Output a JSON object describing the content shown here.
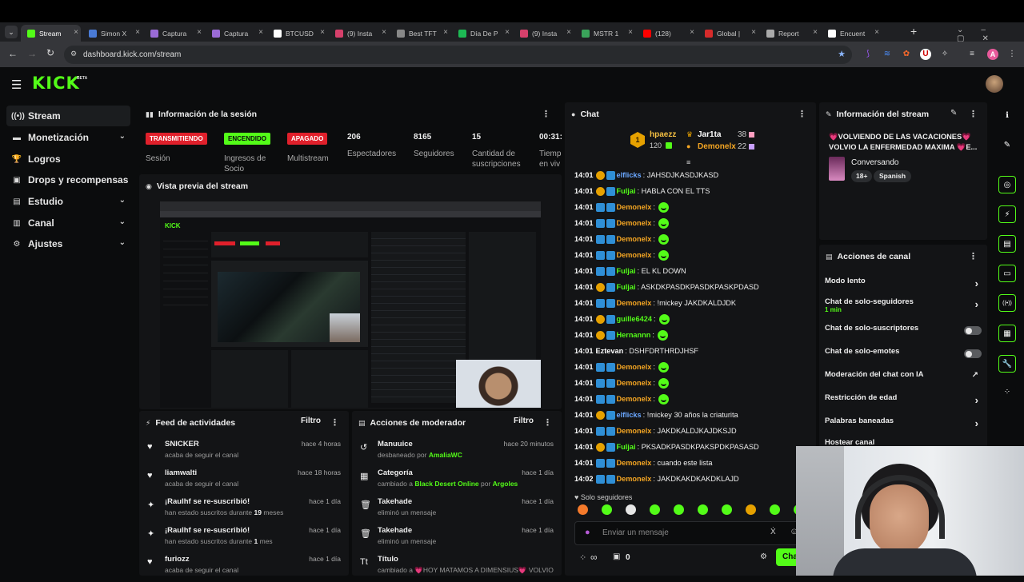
{
  "browser": {
    "tabs": [
      {
        "label": "Stream",
        "color": "#53fc18"
      },
      {
        "label": "Simon X",
        "color": "#4a7bd6"
      },
      {
        "label": "Captura",
        "color": "#9a6bd6"
      },
      {
        "label": "Captura",
        "color": "#9a6bd6"
      },
      {
        "label": "BTCUSD",
        "color": "#ffffff"
      },
      {
        "label": "(9) Insta",
        "color": "#d6406b"
      },
      {
        "label": "Best TFT",
        "color": "#888888"
      },
      {
        "label": "Día De P",
        "color": "#1db954"
      },
      {
        "label": "(9) Insta",
        "color": "#d6406b"
      },
      {
        "label": "MSTR 1",
        "color": "#3aa35a"
      },
      {
        "label": "(128)",
        "color": "#ff0000"
      },
      {
        "label": "Global |",
        "color": "#d62b2b"
      },
      {
        "label": "Report",
        "color": "#aaaaaa"
      },
      {
        "label": "Encuent",
        "color": "#ffffff"
      }
    ],
    "url": "dashboard.kick.com/stream"
  },
  "brand": {
    "logo": "KICK",
    "beta": "BETA",
    "accent": "#53fc18"
  },
  "sidebar": {
    "items": [
      {
        "label": "Stream",
        "icon": "broadcast-icon",
        "glyph": "((•))",
        "chevron": false
      },
      {
        "label": "Monetización",
        "icon": "money-icon",
        "glyph": "▬",
        "chevron": true
      },
      {
        "label": "Logros",
        "icon": "trophy-icon",
        "glyph": "🏆",
        "chevron": false
      },
      {
        "label": "Drops y recompensas",
        "icon": "gift-icon",
        "glyph": "▣",
        "chevron": false
      },
      {
        "label": "Estudio",
        "icon": "book-icon",
        "glyph": "▤",
        "chevron": true
      },
      {
        "label": "Canal",
        "icon": "channel-icon",
        "glyph": "▥",
        "chevron": true
      },
      {
        "label": "Ajustes",
        "icon": "gear-icon",
        "glyph": "⚙",
        "chevron": true
      }
    ]
  },
  "session": {
    "title": "Información de la sesión",
    "badges": [
      {
        "text": "TRANSMITIENDO",
        "label": "Sesión",
        "bg": "#e0202b",
        "fg": "#ffffff"
      },
      {
        "text": "ENCENDIDO",
        "label": "Ingresos de Socio",
        "bg": "#53fc18",
        "fg": "#0b0c0d"
      },
      {
        "text": "APAGADO",
        "label": "Multistream",
        "bg": "#e0202b",
        "fg": "#ffffff"
      }
    ],
    "stats": [
      {
        "value": "206",
        "label": "Espectadores"
      },
      {
        "value": "8165",
        "label": "Seguidores"
      },
      {
        "value": "15",
        "label": "Cantidad de suscripciones"
      },
      {
        "value": "00:31:",
        "label": "Tiemp en viv"
      }
    ]
  },
  "preview": {
    "title": "Vista previa del stream"
  },
  "feed": {
    "title": "Feed de actividades",
    "filter": "Filtro",
    "items": [
      {
        "icon": "heart-icon",
        "glyph": "♥",
        "name": "SNICKER",
        "sub": "acaba de seguir el canal",
        "time": "hace 4 horas"
      },
      {
        "icon": "heart-icon",
        "glyph": "♥",
        "name": "liamwalti",
        "sub": "acaba de seguir el canal",
        "time": "hace 18 horas"
      },
      {
        "icon": "sparkle-icon",
        "glyph": "✦",
        "name": "¡Raulhf se re-suscribió!",
        "sub_pre": "han estado suscritos durante ",
        "sub_num": "19",
        "sub_post": " meses",
        "time": "hace 1 día"
      },
      {
        "icon": "sparkle-icon",
        "glyph": "✦",
        "name": "¡Raulhf se re-suscribió!",
        "sub_pre": "han estado suscritos durante ",
        "sub_num": "1",
        "sub_post": " mes",
        "time": "hace 1 día"
      },
      {
        "icon": "heart-icon",
        "glyph": "♥",
        "name": "furiozz",
        "sub": "acaba de seguir el canal",
        "time": "hace 1 día"
      }
    ]
  },
  "moderator": {
    "title": "Acciones de moderador",
    "filter": "Filtro",
    "items": [
      {
        "icon": "undo-icon",
        "glyph": "↺",
        "name": "Manuuice",
        "sub": "desbaneado por ",
        "who": "AmaliaWC",
        "time": "hace 20 minutos"
      },
      {
        "icon": "category-icon",
        "glyph": "▦",
        "name": "Categoría",
        "sub": "cambiado a ",
        "who": "Black Desert Online",
        "sub2": " por ",
        "who2": "Argoles",
        "time": "hace 1 día"
      },
      {
        "icon": "trash-icon",
        "glyph": "🗑",
        "name": "Takehade",
        "sub": "eliminó un mensaje",
        "time": "hace 1 día"
      },
      {
        "icon": "trash-icon",
        "glyph": "🗑",
        "name": "Takehade",
        "sub": "eliminó un mensaje",
        "time": "hace 1 día"
      },
      {
        "icon": "title-icon",
        "glyph": "Tt",
        "name": "Título",
        "sub": "cambiado a 💗HOY MATAMOS A DIMENSIUS💗 VOLVIO",
        "time": ""
      }
    ]
  },
  "chat": {
    "title": "Chat",
    "leaderboard": {
      "rank": "1",
      "top": {
        "name": "hpaezz",
        "sub": "120"
      },
      "right": [
        {
          "name": "Jar1ta",
          "value": "38"
        },
        {
          "name": "Demonelx",
          "value": "22"
        }
      ]
    },
    "messages": [
      {
        "time": "14:01",
        "user": "elflicks",
        "color": "#6aa7ff",
        "badge": "#e6a100",
        "text": ": JAHSDJKASDJKASD",
        "emote": false
      },
      {
        "time": "14:01",
        "user": "Fuljai",
        "color": "#53fc18",
        "badge": "#e6a100",
        "text": ": HABLA CON EL TTS",
        "emote": false
      },
      {
        "time": "14:01",
        "user": "Demonelx",
        "color": "#f5a623",
        "badge": "#2f8fd6",
        "text": ":",
        "emote": true
      },
      {
        "time": "14:01",
        "user": "Demonelx",
        "color": "#f5a623",
        "badge": "#2f8fd6",
        "text": ":",
        "emote": true
      },
      {
        "time": "14:01",
        "user": "Demonelx",
        "color": "#f5a623",
        "badge": "#2f8fd6",
        "text": ":",
        "emote": true
      },
      {
        "time": "14:01",
        "user": "Demonelx",
        "color": "#f5a623",
        "badge": "#2f8fd6",
        "text": ":",
        "emote": true
      },
      {
        "time": "14:01",
        "user": "Fuljai",
        "color": "#53fc18",
        "badge": "#2f8fd6",
        "text": ": EL KL DOWN",
        "emote": false
      },
      {
        "time": "14:01",
        "user": "Fuljai",
        "color": "#53fc18",
        "badge": "#e6a100",
        "text": ": ASKDKPASDKPASDKPASKPDASD",
        "emote": false
      },
      {
        "time": "14:01",
        "user": "Demonelx",
        "color": "#f5a623",
        "badge": "#2f8fd6",
        "text": ": !mickey JAKDKALDJDK",
        "emote": false
      },
      {
        "time": "14:01",
        "user": "guille6424",
        "color": "#53fc18",
        "badge": "#e6a100",
        "text": ":",
        "emote": true
      },
      {
        "time": "14:01",
        "user": "Hernannn",
        "color": "#53fc18",
        "badge": "#e6a100",
        "text": ":",
        "emote": true
      },
      {
        "time": "14:01",
        "user": "Eztevan",
        "color": "#ffffff",
        "badge": "",
        "text": ": DSHFDRTHRDJHSF",
        "emote": false
      },
      {
        "time": "14:01",
        "user": "Demonelx",
        "color": "#f5a623",
        "badge": "#2f8fd6",
        "text": ":",
        "emote": true
      },
      {
        "time": "14:01",
        "user": "Demonelx",
        "color": "#f5a623",
        "badge": "#2f8fd6",
        "text": ":",
        "emote": true
      },
      {
        "time": "14:01",
        "user": "Demonelx",
        "color": "#f5a623",
        "badge": "#2f8fd6",
        "text": ":",
        "emote": true
      },
      {
        "time": "14:01",
        "user": "elflicks",
        "color": "#6aa7ff",
        "badge": "#e6a100",
        "text": ": !mickey 30 años la criaturita",
        "emote": false
      },
      {
        "time": "14:01",
        "user": "Demonelx",
        "color": "#f5a623",
        "badge": "#2f8fd6",
        "text": ": JAKDKALDJKAJDKSJD",
        "emote": false
      },
      {
        "time": "14:01",
        "user": "Fuljai",
        "color": "#53fc18",
        "badge": "#e6a100",
        "text": ": PKSADKPASDKPAKSPDKPASASD",
        "emote": false
      },
      {
        "time": "14:01",
        "user": "Demonelx",
        "color": "#f5a623",
        "badge": "#2f8fd6",
        "text": ": cuando este lista",
        "emote": false
      },
      {
        "time": "14:02",
        "user": "Demonelx",
        "color": "#f5a623",
        "badge": "#2f8fd6",
        "text": ": JAKDKAKDKAKDKLAJD",
        "emote": false
      }
    ],
    "mode": "Solo seguidores",
    "input_placeholder": "Enviar un mensaje",
    "footer_count": "0",
    "send": "Chat"
  },
  "stream_info": {
    "title": "Información del stream",
    "stream_title": "💗VOLVIENDO DE LAS VACACIONES💗 VOLVIO LA ENFERMEDAD MAXIMA 💗E...",
    "category": "Conversando",
    "tags": [
      "18+",
      "Spanish"
    ]
  },
  "channel_actions": {
    "title": "Acciones de canal",
    "items": [
      {
        "label": "Modo lento",
        "control": "chevron"
      },
      {
        "label": "Chat de solo-seguidores",
        "sub": "1 min",
        "control": "chevron"
      },
      {
        "label": "Chat de solo-suscriptores",
        "control": "toggle"
      },
      {
        "label": "Chat de solo-emotes",
        "control": "toggle"
      },
      {
        "label": "Moderación del chat con IA",
        "control": "external"
      },
      {
        "label": "Restricción de edad",
        "control": "chevron"
      },
      {
        "label": "Palabras baneadas",
        "control": "chevron"
      },
      {
        "label": "Hostear canal",
        "control": "none"
      }
    ]
  },
  "right_rail": [
    {
      "icon": "info-icon",
      "glyph": "ℹ"
    },
    {
      "icon": "pencil-icon",
      "glyph": "✎"
    },
    {
      "icon": "camera-icon",
      "glyph": "◎"
    },
    {
      "icon": "bolt-icon",
      "glyph": "⚡"
    },
    {
      "icon": "document-icon",
      "glyph": "▤"
    },
    {
      "icon": "chat-icon",
      "glyph": "▭"
    },
    {
      "icon": "broadcast-icon",
      "glyph": "((•))"
    },
    {
      "icon": "moderator-icon",
      "glyph": "▦"
    },
    {
      "icon": "wrench-icon",
      "glyph": "🔧"
    },
    {
      "icon": "users-icon",
      "glyph": "⁘"
    }
  ]
}
